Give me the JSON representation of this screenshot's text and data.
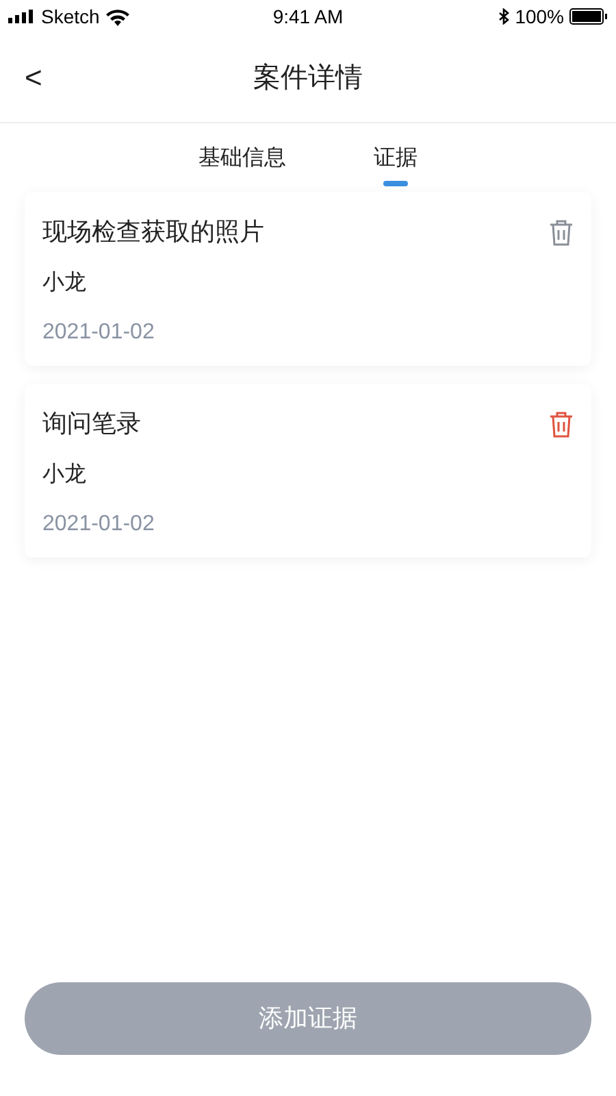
{
  "status_bar": {
    "carrier": "Sketch",
    "time": "9:41 AM",
    "battery": "100%"
  },
  "nav": {
    "back": "<",
    "title": "案件详情"
  },
  "tabs": [
    {
      "label": "基础信息",
      "selected": false
    },
    {
      "label": "证据",
      "selected": true
    }
  ],
  "evidence": [
    {
      "title": "现场检查获取的照片",
      "person": "小龙",
      "date": "2021-01-02",
      "delete_highlighted": false
    },
    {
      "title": "询问笔录",
      "person": "小龙",
      "date": "2021-01-02",
      "delete_highlighted": true
    }
  ],
  "add_button": {
    "label": "添加证据",
    "disabled": true
  }
}
